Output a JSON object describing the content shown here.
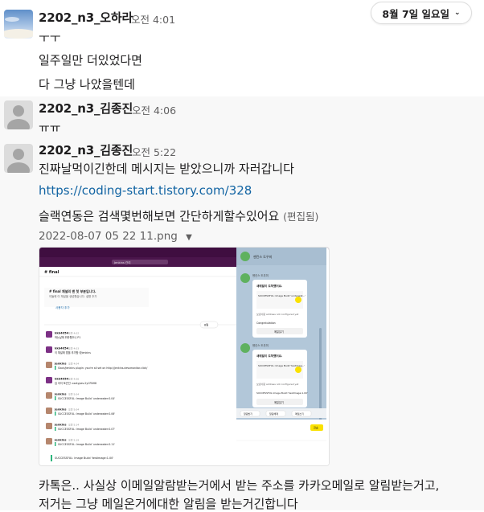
{
  "date_divider": "8월 7일 일요일",
  "messages": [
    {
      "name": "2202_n3_오하라",
      "time": "오전 4:01",
      "lines": [
        "ㅜㅜ",
        "일주일만 더있었다면",
        "다 그냥 나았을텐데"
      ]
    },
    {
      "name": "2202_n3_김종진",
      "time": "오전 4:06",
      "lines": [
        "ㅠㅠ"
      ]
    },
    {
      "name": "2202_n3_김종진",
      "time": "오전 5:22",
      "line1": "진짜날먹이긴한데 메시지는 받았으니까 자러갑니다",
      "link": "https://coding-start.tistory.com/328",
      "line3": "슬랙연동은 검색몇번해보면 간단하게할수있어요",
      "edited": "(편집됨)",
      "file_name": "2022-08-07 05 22 11.png",
      "after_lines": [
        "카톡은.. 사실상 이메일알람받는거에서 받는 주소를 카카오메일로 알림받는거고,",
        "저거는 그냥 메일온거에대한 알림을 받는거긴합니다"
      ]
    }
  ],
  "screenshot": {
    "channel": "# final",
    "tab": "Jenkins 관리",
    "notice_title": "# final 채널의 맨 첫 부분입니다.",
    "notice_sub": "이들에 이 채널을 생성했습니다. 설명 추가",
    "add_member": "사용자 추가",
    "divider_label": "8월",
    "entries": [
      {
        "user": "kkk4054",
        "time": "오전 4:02",
        "text": "하는날에 뭐라했으니 P1"
      },
      {
        "user": "kkk4054",
        "time": "오전 4:03",
        "text": "이 채널에 앱을 추가함 @jenkins"
      },
      {
        "user": "jenkins",
        "time": "오전 4:04",
        "text": "Slack/Jenkins plugin: you're all set on http://jenkins.devsmonitor.click/"
      },
      {
        "user": "kkk4054",
        "time": "오전 4:06",
        "text": "입 아이 토큰인: xxxtypes-2yCFNH8"
      },
      {
        "user": "jenkins",
        "time": "오전 5:04",
        "text": "SUCCESSFUL: Image Build 'underwater:0.04'"
      },
      {
        "user": "jenkins",
        "time": "오전 5:04",
        "text": "SUCCESSFUL: Image Build 'underwater:0.06'"
      },
      {
        "user": "jenkins",
        "time": "오전 5:14",
        "text": "SUCCESSFUL: Image Build 'underwater:0.07'"
      },
      {
        "user": "jenkins",
        "time": "오전 5:19",
        "text": "SUCCESSFUL: Image Build 'underwater:0.11'"
      }
    ],
    "last_line": "SUCCESSFUL: Image Build 'testimage:1.00'",
    "kakao": {
      "header": "젠킨스 도우미",
      "sender": "젠킨스 도우미",
      "card_title": "새메일이 도착했어요.",
      "card_status": "SUCCESSFUL: Image Build 'underwat...'",
      "card_from": "보낸사람  address not configured yet",
      "card_congrats": "Congratulation",
      "card_button": "메일읽기",
      "card2_status": "SUCCESSFUL: Image Build 'testimag...'",
      "card2_body": "SUCCESSFUL Image Build 'testimage:1.00'",
      "bottom_tabs": [
        "알림받기",
        "알림해제",
        "메일쓰기"
      ],
      "send_label": "전송"
    }
  }
}
